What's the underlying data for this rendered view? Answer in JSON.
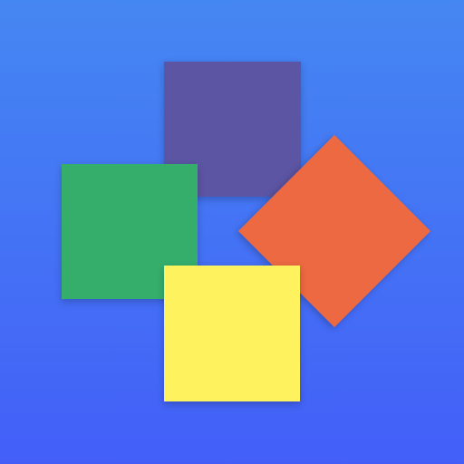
{
  "background": {
    "gradient_top": "#4587F2",
    "gradient_bottom": "#435FF8"
  },
  "tiles": [
    {
      "id": "purple",
      "color": "#5B55A4",
      "rotated": false
    },
    {
      "id": "green",
      "color": "#35AE6C",
      "rotated": false
    },
    {
      "id": "orange",
      "color": "#EC6942",
      "rotated": true
    },
    {
      "id": "yellow",
      "color": "#FEF35E",
      "rotated": false
    }
  ]
}
